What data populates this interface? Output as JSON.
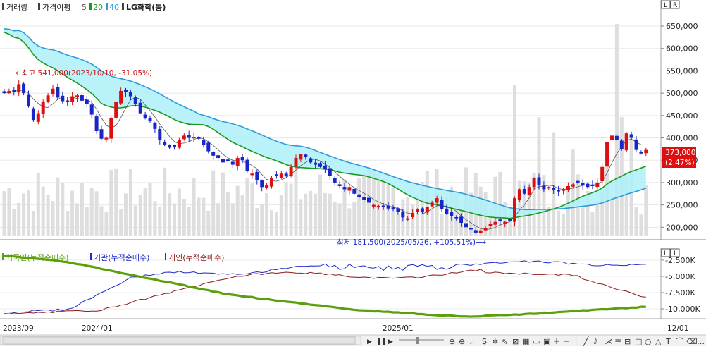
{
  "legend": {
    "vol": "거래량",
    "ma_label": "가격이평",
    "ma_periods": [
      "5",
      "20",
      "40"
    ],
    "ma_colors": [
      "#555555",
      "#1a9a1a",
      "#2f9ad8"
    ],
    "title": "LG화학(통)"
  },
  "corner": {
    "top": "L",
    "top_r": "R",
    "bottom": "L",
    "bottom_r": "I"
  },
  "annotations": {
    "high": "←최고 541,000(2023/10/10, -31.05%)",
    "low": "최저 181,500(2025/05/26, +105.51%)⟶"
  },
  "current_price": {
    "value": "373,000",
    "change": "(2.47%)"
  },
  "lower_legend": [
    {
      "label": "외국인(누적순매수)",
      "color": "#5aa00a"
    },
    {
      "label": "기관(누적순매수)",
      "color": "#1c28c8"
    },
    {
      "label": "개인(누적순매수)",
      "color": "#8b1a1a"
    }
  ],
  "x_labels": [
    "2023/09",
    "2024/01",
    "2025/01",
    "12/01"
  ],
  "colors": {
    "up": "#dc1010",
    "down": "#1826c8",
    "band": "#aef0f8",
    "volume": "#dedede"
  },
  "chart_data": [
    {
      "type": "candlestick",
      "ylim": [
        180000,
        680000
      ],
      "yticks": [
        200000,
        250000,
        300000,
        350000,
        400000,
        450000,
        500000,
        550000,
        600000,
        650000
      ],
      "ytick_labels": [
        "200,000",
        "250,000",
        "300,000",
        "350,000",
        "400,000",
        "450,000",
        "500,000",
        "550,000",
        "600,000",
        "650,000"
      ],
      "close": [
        500000,
        505000,
        503000,
        520000,
        500000,
        470000,
        440000,
        455000,
        480000,
        495000,
        510000,
        490000,
        482000,
        480000,
        493000,
        495000,
        483000,
        475000,
        452000,
        415000,
        398000,
        400000,
        445000,
        480000,
        505000,
        502000,
        493000,
        475000,
        455000,
        445000,
        438000,
        420000,
        395000,
        385000,
        378000,
        380000,
        395000,
        405000,
        400000,
        402000,
        398000,
        385000,
        370000,
        360000,
        355000,
        345000,
        348000,
        340000,
        355000,
        350000,
        325000,
        320000,
        305000,
        290000,
        295000,
        310000,
        315000,
        320000,
        315000,
        335000,
        355000,
        363000,
        358000,
        345000,
        340000,
        335000,
        330000,
        315000,
        300000,
        292000,
        285000,
        290000,
        275000,
        268000,
        262000,
        255000,
        250000,
        248000,
        245000,
        242000,
        240000,
        235000,
        222000,
        220000,
        232000,
        240000,
        235000,
        245000,
        255000,
        265000,
        240000,
        230000,
        225000,
        220000,
        210000,
        200000,
        195000,
        188000,
        193000,
        198000,
        208000,
        212000,
        214000,
        212000,
        215000,
        265000,
        285000,
        275000,
        290000,
        310000,
        295000,
        285000,
        290000,
        283000,
        280000,
        285000,
        292000,
        296000,
        300000,
        295000,
        290000,
        292000,
        300000,
        335000,
        390000,
        405000,
        395000,
        375000,
        410000,
        400000,
        373000,
        365000,
        373000
      ],
      "annotations": [
        "최고 541,000 (2023/10/10)",
        "최저 181,500 (2025/05/26)"
      ]
    },
    {
      "type": "line",
      "series": [
        {
          "name": "외국인(누적순매수)"
        },
        {
          "name": "기관(누적순매수)"
        },
        {
          "name": "개인(누적순매수)"
        }
      ],
      "ylim": [
        -11300,
        -1100
      ],
      "yticks": [
        -2500,
        -5000,
        -7500,
        -10000
      ],
      "ytick_labels": [
        "-2,500K",
        "-5,000K",
        "-7,500K",
        "-10,000K"
      ]
    }
  ]
}
